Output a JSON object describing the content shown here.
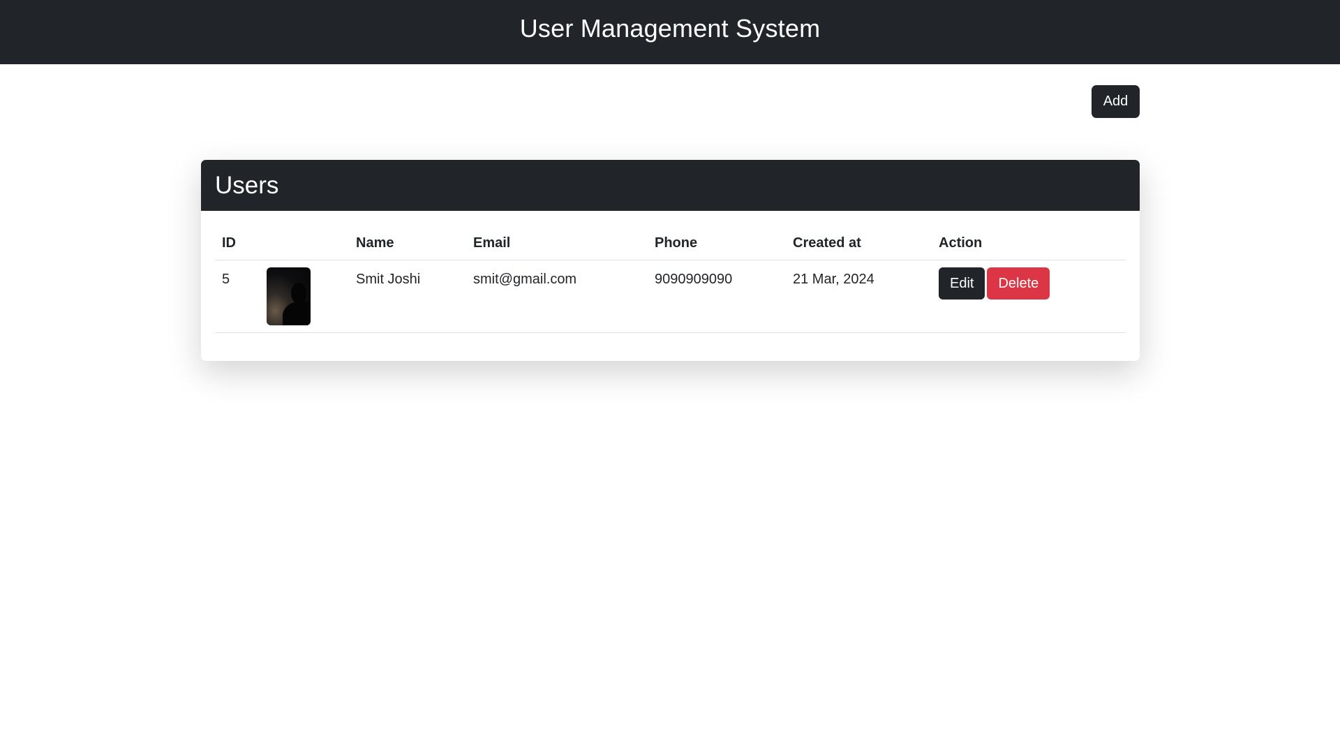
{
  "navbar": {
    "title": "User Management System"
  },
  "toolbar": {
    "add_label": "Add"
  },
  "card": {
    "title": "Users",
    "columns": [
      "ID",
      "",
      "Name",
      "Email",
      "Phone",
      "Created at",
      "Action"
    ],
    "rows": [
      {
        "id": "5",
        "name": "Smit Joshi",
        "email": "smit@gmail.com",
        "phone": "9090909090",
        "created_at": "21 Mar, 2024",
        "edit_label": "Edit",
        "delete_label": "Delete"
      }
    ]
  },
  "colors": {
    "dark": "#212529",
    "danger": "#dc3545",
    "background": "#ffffff"
  }
}
